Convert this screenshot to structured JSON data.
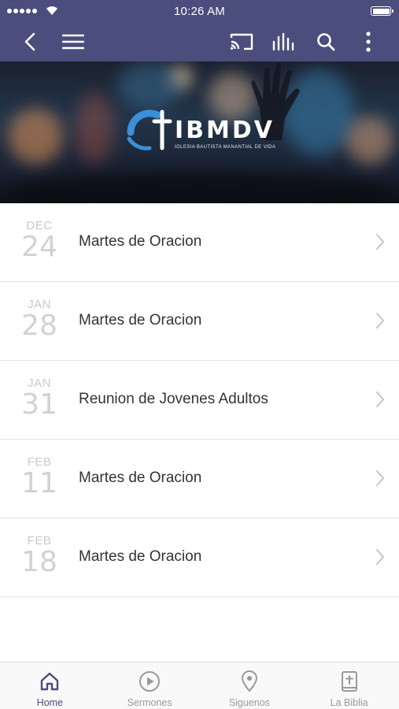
{
  "status_bar": {
    "time": "10:26 AM"
  },
  "toolbar": {
    "icons": [
      "back-icon",
      "menu-icon",
      "cast-icon",
      "equalizer-icon",
      "search-icon",
      "more-vertical-icon"
    ]
  },
  "banner": {
    "logo_text": "IBMDV",
    "logo_subtitle": "IGLESIA BAUTISTA MANANTIAL DE VIDA"
  },
  "events": [
    {
      "month": "DEC",
      "day": "24",
      "title": "Martes de Oracion"
    },
    {
      "month": "JAN",
      "day": "28",
      "title": "Martes de Oracion"
    },
    {
      "month": "JAN",
      "day": "31",
      "title": "Reunion de Jovenes Adultos"
    },
    {
      "month": "FEB",
      "day": "11",
      "title": "Martes de Oracion"
    },
    {
      "month": "FEB",
      "day": "18",
      "title": "Martes de Oracion"
    }
  ],
  "tabbar": {
    "tabs": [
      {
        "label": "Home",
        "icon": "home-icon",
        "active": true
      },
      {
        "label": "Sermones",
        "icon": "play-circle-icon",
        "active": false
      },
      {
        "label": "Siguenos",
        "icon": "location-pin-icon",
        "active": false
      },
      {
        "label": "La Biblia",
        "icon": "bible-icon",
        "active": false
      }
    ]
  },
  "colors": {
    "brand": "#4b4d7c",
    "date_text": "#c9c9c9",
    "tab_inactive": "#9a9a9a"
  }
}
